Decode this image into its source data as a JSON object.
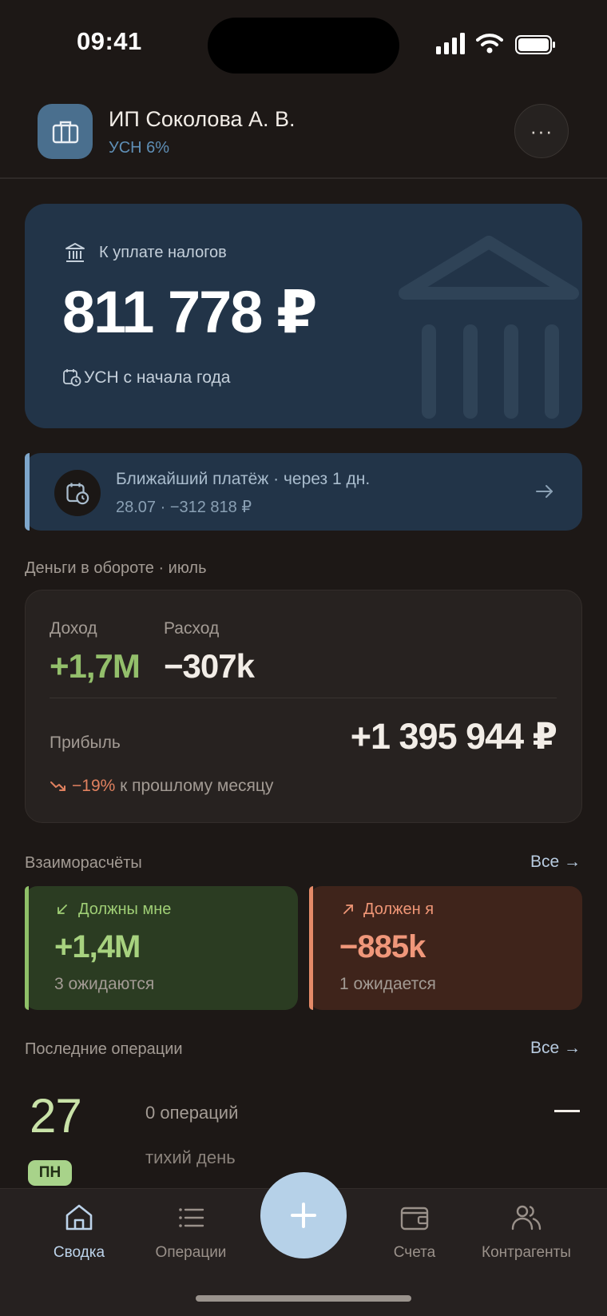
{
  "status_bar": {
    "time": "09:41"
  },
  "header": {
    "org_name": "ИП Соколова А. В.",
    "tax_regime": "УСН 6%",
    "more_label": "···"
  },
  "tax_card": {
    "label": "К уплате налогов",
    "amount": "811 778 ₽",
    "note": "УСН с начала года"
  },
  "next_payment": {
    "title": "Ближайший платёж · через 1 дн.",
    "subtitle": "28.07 · −312 818 ₽"
  },
  "money": {
    "section_title": "Деньги в обороте · июль",
    "income_label": "Доход",
    "income_value": "+1,7M",
    "expense_label": "Расход",
    "expense_value": "−307k",
    "profit_label": "Прибыль",
    "profit_value": "+1 395 944 ₽",
    "trend_value": "−19%",
    "trend_text": "к прошлому месяцу"
  },
  "settlements": {
    "section_title": "Взаиморасчёты",
    "all_link": "Все →",
    "owed_to_me_label": "Должны мне",
    "owed_to_me_value": "+1,4M",
    "owed_to_me_sub": "3 ожидаются",
    "i_owe_label": "Должен я",
    "i_owe_value": "−885k",
    "i_owe_sub": "1 ожидается"
  },
  "recent": {
    "section_title": "Последние операции",
    "all_link": "Все →",
    "day_number": "27",
    "day_badge": "ПН",
    "ops_count": "0 операций",
    "ops_note": "тихий день"
  },
  "tabs": [
    {
      "label": "Сводка",
      "icon": "home-icon",
      "active": true
    },
    {
      "label": "Операции",
      "icon": "list-icon",
      "active": false
    },
    {
      "label": "Счета",
      "icon": "wallet-icon",
      "active": false
    },
    {
      "label": "Контрагенты",
      "icon": "people-icon",
      "active": false
    }
  ],
  "colors": {
    "background": "#1d1816",
    "accent_blue": "#223448",
    "income_green": "#93bf6b",
    "negative_red": "#e0815f",
    "fab": "#b6d1e8"
  }
}
